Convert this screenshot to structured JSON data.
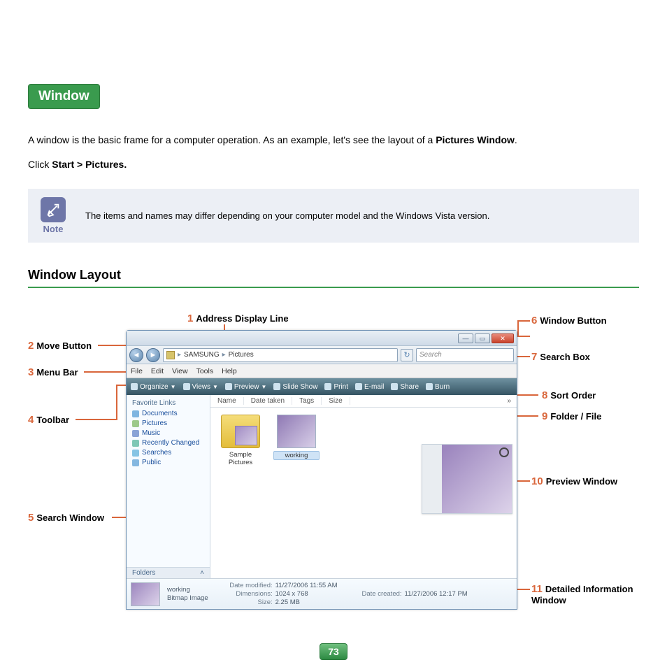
{
  "heading": "Window",
  "intro_pre": "A window is the basic frame for a computer operation. As an example, let's see the layout of a ",
  "intro_bold": "Pictures Window",
  "intro_post": ".",
  "click_pre": "Click ",
  "click_bold": "Start > Pictures.",
  "note": {
    "label": "Note",
    "text": "The items and names may differ depending on your computer model and the Windows Vista version."
  },
  "section_title": "Window Layout",
  "callouts": {
    "c1": {
      "num": "1",
      "label": "Address Display Line"
    },
    "c2": {
      "num": "2",
      "label": "Move Button"
    },
    "c3": {
      "num": "3",
      "label": "Menu Bar"
    },
    "c4": {
      "num": "4",
      "label": "Toolbar"
    },
    "c5": {
      "num": "5",
      "label": "Search Window"
    },
    "c6": {
      "num": "6",
      "label": "Window Button"
    },
    "c7": {
      "num": "7",
      "label": "Search Box"
    },
    "c8": {
      "num": "8",
      "label": "Sort Order"
    },
    "c9": {
      "num": "9",
      "label": "Folder / File"
    },
    "c10": {
      "num": "10",
      "label": "Preview Window"
    },
    "c11": {
      "num": "11",
      "label": "Detailed Information Window"
    }
  },
  "vista": {
    "breadcrumb": {
      "seg1": "SAMSUNG",
      "seg2": "Pictures"
    },
    "search_placeholder": "Search",
    "menubar": [
      "File",
      "Edit",
      "View",
      "Tools",
      "Help"
    ],
    "toolbar": [
      "Organize",
      "Views",
      "Preview",
      "Slide Show",
      "Print",
      "E-mail",
      "Share",
      "Burn"
    ],
    "sidebar_header": "Favorite Links",
    "sidebar": [
      "Documents",
      "Pictures",
      "Music",
      "Recently Changed",
      "Searches",
      "Public"
    ],
    "folders_header": "Folders",
    "columns": [
      "Name",
      "Date taken",
      "Tags",
      "Size"
    ],
    "columns_expand": "»",
    "items": [
      {
        "label": "Sample Pictures"
      },
      {
        "label": "working"
      }
    ],
    "details": {
      "name": "working",
      "type": "Bitmap Image",
      "modified_k": "Date modified:",
      "modified_v": "11/27/2006 11:55 AM",
      "dimensions_k": "Dimensions:",
      "dimensions_v": "1024 x 768",
      "size_k": "Size:",
      "size_v": "2.25 MB",
      "created_k": "Date created:",
      "created_v": "11/27/2006 12:17 PM"
    },
    "winbtn_min": "—",
    "winbtn_max": "▭",
    "winbtn_close": "✕"
  },
  "page_number": "73"
}
